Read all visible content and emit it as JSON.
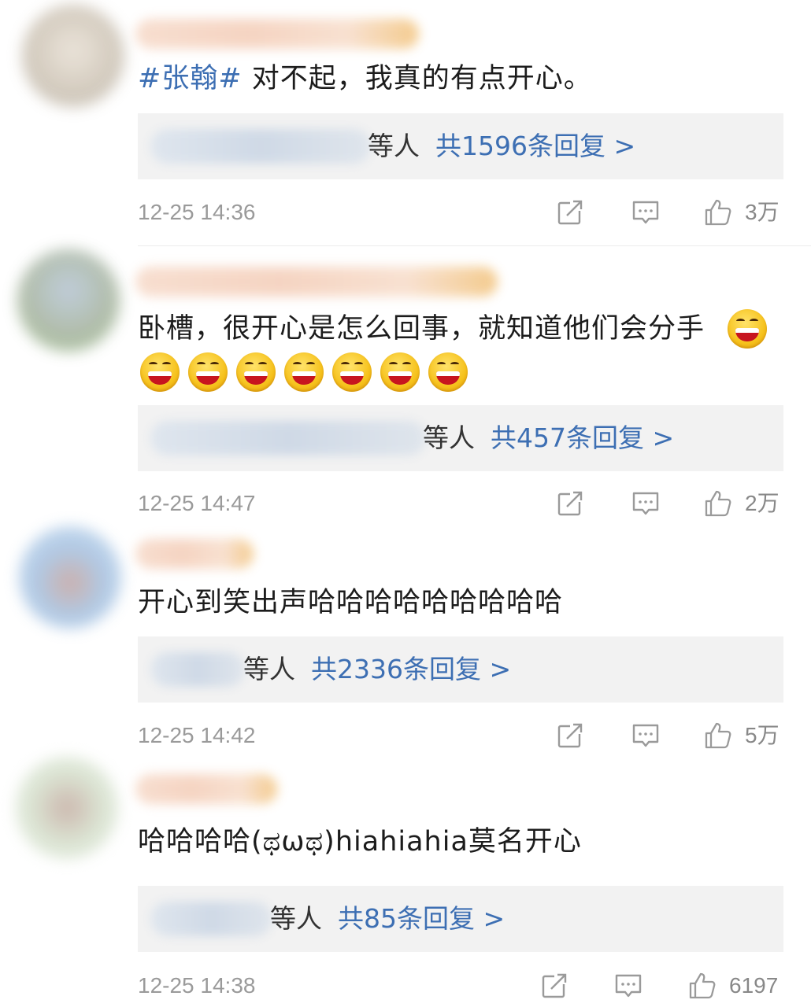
{
  "comments": [
    {
      "text_hashtag": "#张翰#",
      "text": "对不起，我真的有点开心。",
      "replies_suffix": "等人",
      "replies_count": "共1596条回复 >",
      "time": "12-25 14:36",
      "likes": "3万"
    },
    {
      "text": "卧槽，很开心是怎么回事，就知道他们会分手",
      "emoji_count": 8,
      "replies_suffix": "等人",
      "replies_count": "共457条回复 >",
      "time": "12-25 14:47",
      "likes": "2万"
    },
    {
      "text": "开心到笑出声哈哈哈哈哈哈哈哈哈",
      "replies_suffix": "等人",
      "replies_count": "共2336条回复 >",
      "time": "12-25 14:42",
      "likes": "5万"
    },
    {
      "text": "哈哈哈哈(ಥωಥ)hiahiahia莫名开心",
      "replies_suffix": "等人",
      "replies_count": "共85条回复 >",
      "time": "12-25 14:38",
      "likes": "6197"
    }
  ],
  "icons": {
    "share": "share-icon",
    "comment": "comment-icon",
    "like": "thumbs-up-icon"
  },
  "colors": {
    "link": "#3d6fb3",
    "meta": "#9a9a9a",
    "reply_bg": "#f2f2f2"
  }
}
